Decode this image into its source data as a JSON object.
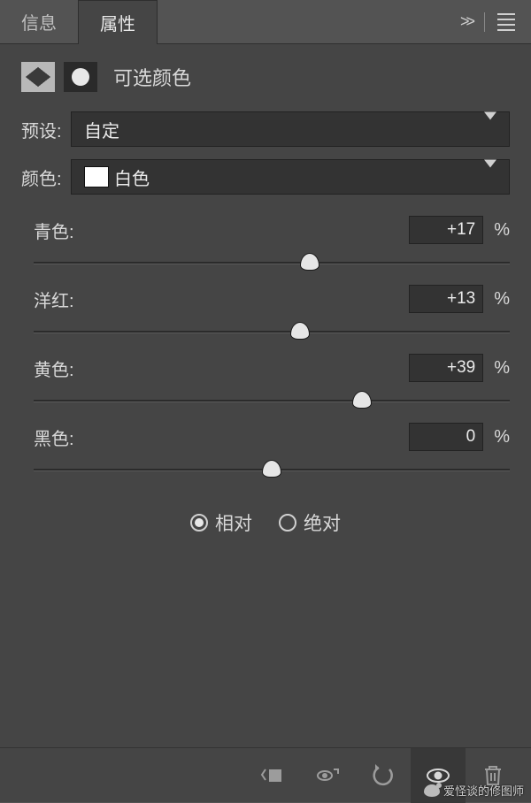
{
  "tabs": {
    "info": "信息",
    "properties": "属性"
  },
  "header": {
    "title": "可选颜色"
  },
  "preset": {
    "label": "预设:",
    "value": "自定"
  },
  "color": {
    "label": "颜色:",
    "value": "白色",
    "swatch": "#ffffff"
  },
  "sliders": [
    {
      "label": "青色:",
      "value": "+17",
      "percent": 58
    },
    {
      "label": "洋红:",
      "value": "+13",
      "percent": 56
    },
    {
      "label": "黄色:",
      "value": "+39",
      "percent": 69
    },
    {
      "label": "黑色:",
      "value": "0",
      "percent": 50
    }
  ],
  "percent_suffix": "%",
  "mode": {
    "relative": "相对",
    "absolute": "绝对",
    "selected": "relative"
  },
  "watermark": "爱怪谈的修图师"
}
